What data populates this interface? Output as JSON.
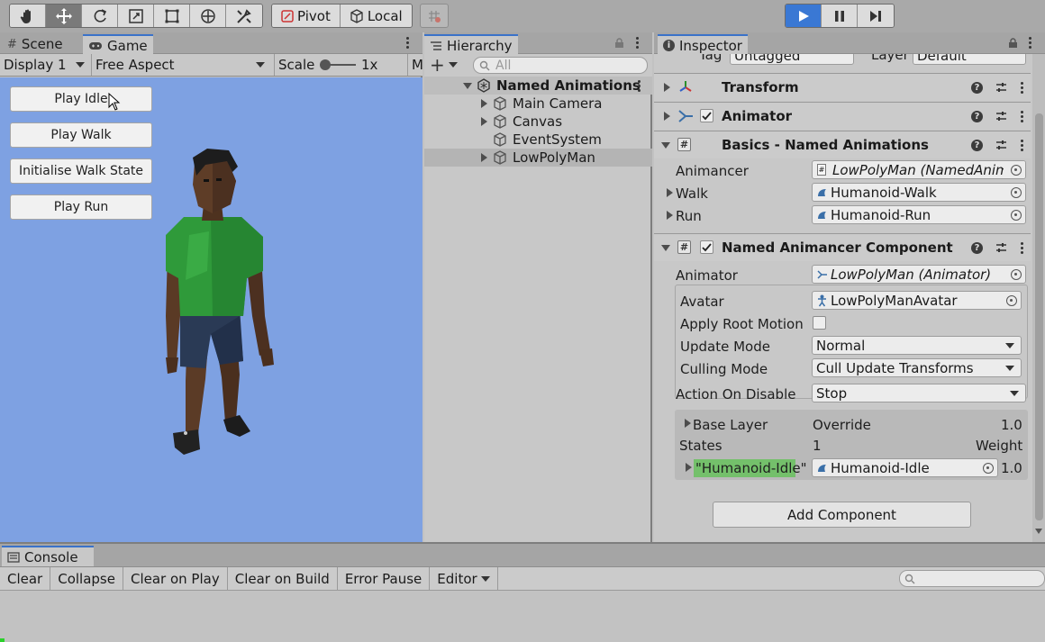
{
  "toolbar": {
    "pivot_label": "Pivot",
    "local_label": "Local"
  },
  "game": {
    "tabs": {
      "scene": "Scene",
      "game": "Game"
    },
    "display": "Display 1",
    "aspect": "Free Aspect",
    "scale_label": "Scale",
    "scale_value": "1x",
    "maximize_cut": "M",
    "buttons": [
      "Play Idle",
      "Play Walk",
      "Initialise Walk State",
      "Play Run"
    ]
  },
  "hierarchy": {
    "title": "Hierarchy",
    "search_placeholder": "All",
    "scene_name": "Named Animations",
    "items": [
      "Main Camera",
      "Canvas",
      "EventSystem",
      "LowPolyMan"
    ]
  },
  "inspector": {
    "title": "Inspector",
    "tag_label": "Tag",
    "tag_value": "Untagged",
    "layer_label": "Layer",
    "layer_value": "Default",
    "components": {
      "transform": "Transform",
      "animator": "Animator",
      "basics": "Basics - Named Animations",
      "named": "Named Animancer Component"
    },
    "basics_props": {
      "animancer_label": "Animancer",
      "animancer_value": "LowPolyMan (NamedAnimancerComponent)",
      "walk_label": "Walk",
      "walk_value": "Humanoid-Walk",
      "run_label": "Run",
      "run_value": "Humanoid-Run"
    },
    "named_props": {
      "animator_label": "Animator",
      "animator_value": "LowPolyMan (Animator)",
      "avatar_label": "Avatar",
      "avatar_value": "LowPolyManAvatar",
      "root_motion_label": "Apply Root Motion",
      "update_mode_label": "Update Mode",
      "update_mode_value": "Normal",
      "culling_label": "Culling Mode",
      "culling_value": "Cull Update Transforms",
      "disable_label": "Action On Disable",
      "disable_value": "Stop"
    },
    "layers": {
      "base_layer": "Base Layer",
      "override": "Override",
      "base_weight": "1.0",
      "states_label": "States",
      "states_count": "1",
      "weight_label": "Weight",
      "state_key": "\"Humanoid-Idle\"",
      "state_clip": "Humanoid-Idle",
      "state_weight": "1.0"
    },
    "add_component": "Add Component"
  },
  "console": {
    "title": "Console",
    "buttons": [
      "Clear",
      "Collapse",
      "Clear on Play",
      "Clear on Build",
      "Error Pause",
      "Editor"
    ]
  },
  "colors": {
    "game_bg": "#7ea1e2",
    "play_active": "#3a78d4",
    "state_highlight": "#74c06b",
    "shirt": "#2f9a3a"
  }
}
